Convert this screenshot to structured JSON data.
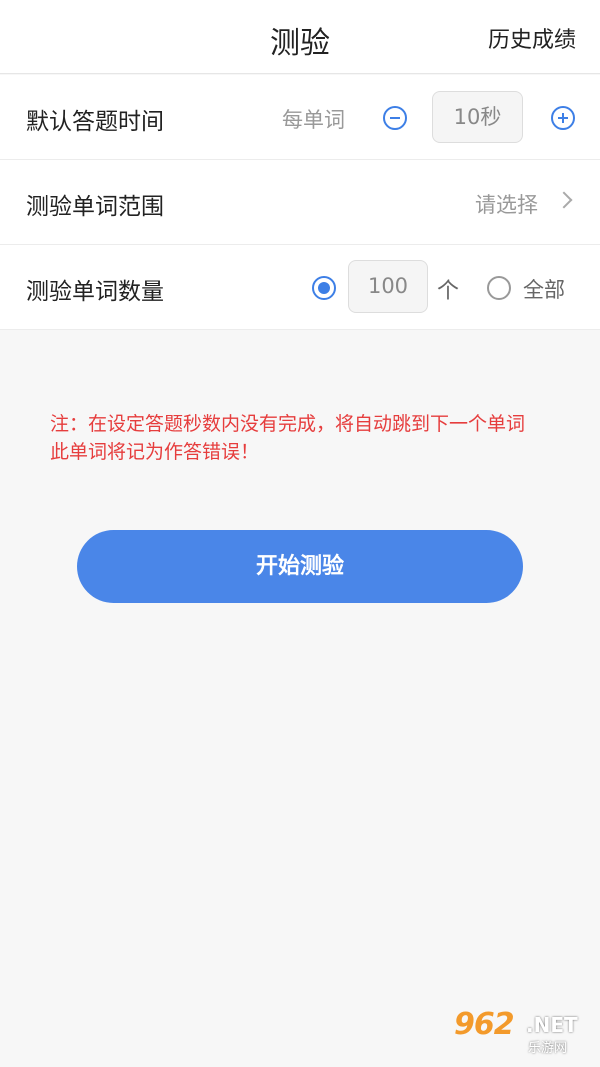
{
  "header": {
    "title": "测验",
    "history_label": "历史成绩"
  },
  "settings": {
    "time": {
      "label": "默认答题时间",
      "per_word": "每单词",
      "value": "10秒",
      "decrement_icon": "minus-circle-icon",
      "increment_icon": "plus-circle-icon"
    },
    "range": {
      "label": "测验单词范围",
      "value": "请选择",
      "chevron_icon": "chevron-right-icon"
    },
    "count": {
      "label": "测验单词数量",
      "value": "100",
      "unit": "个",
      "all_label": "全部",
      "selected": "count"
    }
  },
  "note": "注：在设定答题秒数内没有完成，将自动跳到下一个单词 此单词将记为作答错误！",
  "start_button": "开始测验",
  "watermark": {
    "number": "962",
    "net": ".NET",
    "cn": "乐游网"
  },
  "colors": {
    "accent": "#4a86e8",
    "warning": "#e63d3d",
    "background": "#f7f7f7"
  }
}
